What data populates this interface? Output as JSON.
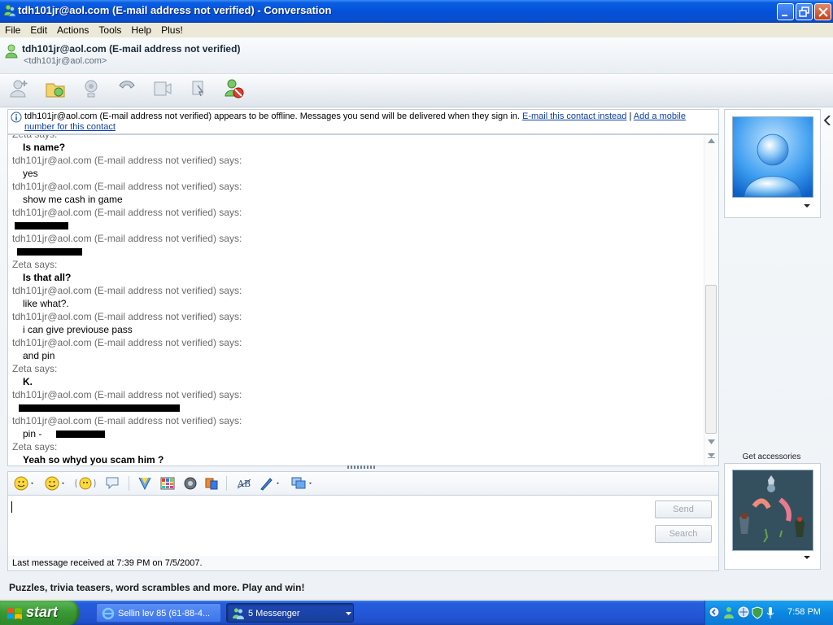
{
  "window": {
    "title": "tdh101jr@aol.com (E-mail address not verified) - Conversation"
  },
  "menu": [
    "File",
    "Edit",
    "Actions",
    "Tools",
    "Help",
    "Plus!"
  ],
  "contact": {
    "name": "tdh101jr@aol.com (E-mail address not verified)",
    "address": "<tdh101jr@aol.com>"
  },
  "toolbar_icons": [
    "invite-icon",
    "send-files-icon",
    "webcam-icon",
    "call-icon",
    "video-icon",
    "activities-icon",
    "block-icon"
  ],
  "infobar": {
    "text": "tdh101jr@aol.com (E-mail address not verified) appears to be offline. Messages you send will be delivered when they sign in.",
    "link_email": "E-mail this contact instead",
    "separator": "|",
    "link_mobile": "Add a mobile number for this contact"
  },
  "messages": [
    {
      "sender": "Zeta says:",
      "text": "Is name?",
      "bold": true
    },
    {
      "sender": "tdh101jr@aol.com (E-mail address not verified) says:",
      "text": "yes",
      "bold": false
    },
    {
      "sender": "tdh101jr@aol.com (E-mail address not verified) says:",
      "text": "show me cash in game",
      "bold": false
    },
    {
      "sender": "tdh101jr@aol.com (E-mail address not verified) says:",
      "text": "",
      "bold": false,
      "redacted": true
    },
    {
      "sender": "tdh101jr@aol.com (E-mail address not verified) says:",
      "text": "",
      "bold": false,
      "redacted": true
    },
    {
      "sender": "Zeta says:",
      "text": "Is that all?",
      "bold": true
    },
    {
      "sender": "tdh101jr@aol.com (E-mail address not verified) says:",
      "text": "like what?.",
      "bold": false
    },
    {
      "sender": "tdh101jr@aol.com (E-mail address not verified) says:",
      "text": "i can give previouse pass",
      "bold": false
    },
    {
      "sender": "tdh101jr@aol.com (E-mail address not verified) says:",
      "text": "and pin",
      "bold": false
    },
    {
      "sender": "Zeta says:",
      "text": "K.",
      "bold": true
    },
    {
      "sender": "tdh101jr@aol.com (E-mail address not verified) says:",
      "text": "",
      "bold": false,
      "redacted": true
    },
    {
      "sender": "tdh101jr@aol.com (E-mail address not verified) says:",
      "text": "pin -",
      "bold": false,
      "redacted": true
    },
    {
      "sender": "Zeta says:",
      "text": "Yeah so whyd you scam him ?",
      "bold": true
    }
  ],
  "compose": {
    "send_label": "Send",
    "search_label": "Search",
    "status": "Last message received at 7:39 PM on 7/5/2007."
  },
  "promo": "Puzzles, trivia teasers, word scrambles and more. Play and win!",
  "right_panel": {
    "accessories_label": "Get accessories"
  },
  "taskbar": {
    "start_label": "start",
    "tasks": [
      {
        "label": "Sellin lev 85 (61-88-4...",
        "active": false
      },
      {
        "label": "5 Messenger",
        "active": true
      }
    ],
    "clock": "7:58 PM"
  },
  "colors": {
    "link": "#0a3ea8",
    "titlebar": "#0450d8",
    "taskbar": "#245edb",
    "start_green": "#3a9a35"
  }
}
